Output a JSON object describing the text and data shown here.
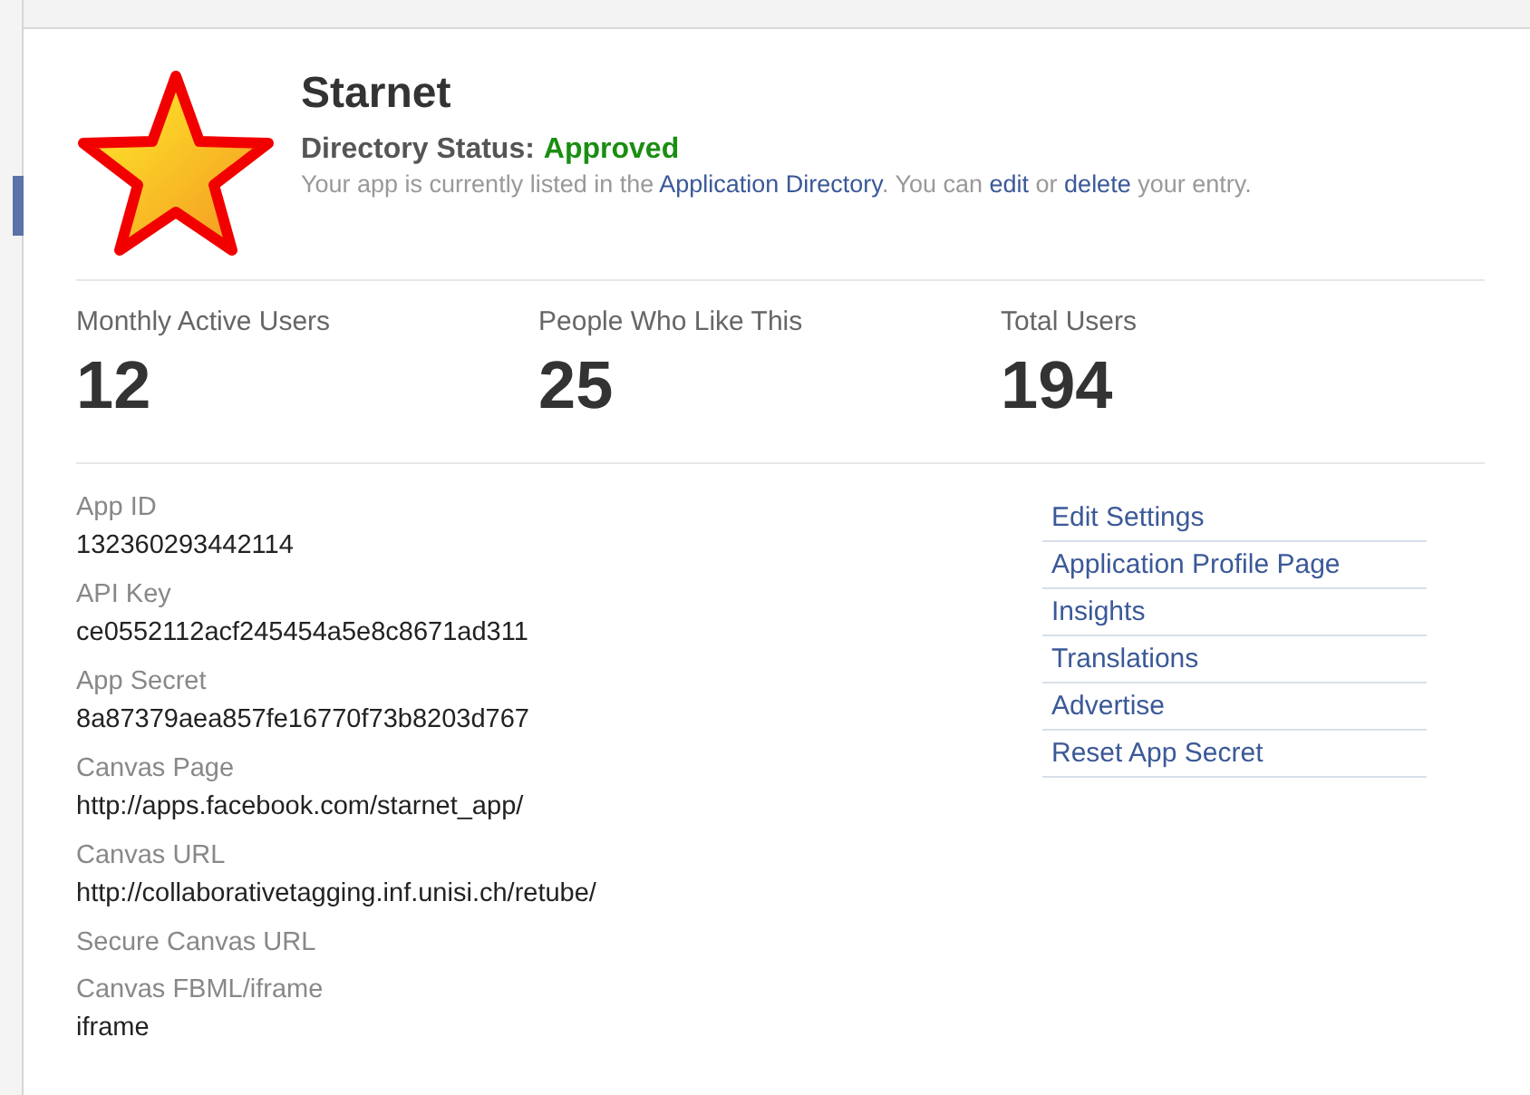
{
  "app": {
    "name": "Starnet",
    "status_label": "Directory Status:",
    "status_value": "Approved",
    "description": [
      {
        "kind": "text",
        "text": "Your app is currently listed in the "
      },
      {
        "kind": "link",
        "text": "Application Directory"
      },
      {
        "kind": "text",
        "text": ". You can "
      },
      {
        "kind": "link",
        "text": "edit"
      },
      {
        "kind": "text",
        "text": " or "
      },
      {
        "kind": "link",
        "text": "delete"
      },
      {
        "kind": "text",
        "text": " your entry."
      }
    ]
  },
  "stats": [
    {
      "label": "Monthly Active Users",
      "value": "12"
    },
    {
      "label": "People Who Like This",
      "value": "25"
    },
    {
      "label": "Total Users",
      "value": "194"
    }
  ],
  "fields": [
    {
      "label": "App ID",
      "value": "132360293442114"
    },
    {
      "label": "API Key",
      "value": "ce0552112acf245454a5e8c8671ad311"
    },
    {
      "label": "App Secret",
      "value": "8a87379aea857fe16770f73b8203d767"
    },
    {
      "label": "Canvas Page",
      "value": "http://apps.facebook.com/starnet_app/"
    },
    {
      "label": "Canvas URL",
      "value": "http://collaborativetagging.inf.unisi.ch/retube/"
    },
    {
      "label": "Secure Canvas URL"
    },
    {
      "label": "Canvas FBML/iframe",
      "value": "iframe"
    }
  ],
  "links": [
    "Edit Settings",
    "Application Profile Page",
    "Insights",
    "Translations",
    "Advertise",
    "Reset App Secret"
  ]
}
